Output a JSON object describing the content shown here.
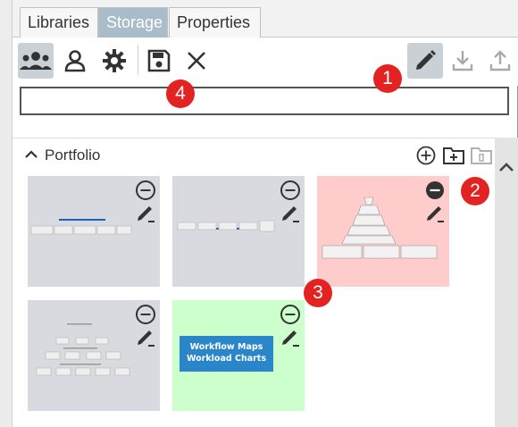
{
  "tabs": [
    {
      "label": "Libraries"
    },
    {
      "label": "Storage"
    },
    {
      "label": "Properties"
    }
  ],
  "toolbar": {
    "icons": [
      "users-icon",
      "user-icon",
      "gear-icon",
      "save-icon",
      "close-icon",
      "edit-icon",
      "download-icon",
      "upload-icon"
    ]
  },
  "search": {
    "value": "",
    "placeholder": ""
  },
  "badges": [
    "1",
    "2",
    "3",
    "4"
  ],
  "library": {
    "title": "Portfolio",
    "items": [
      {
        "thumb_color": "#d9d9e0"
      },
      {
        "thumb_color": "#d9d9e0"
      },
      {
        "thumb_color": "#ffcccc"
      },
      {
        "thumb_color": "#d9d9e0"
      },
      {
        "thumb_color": "#ccffcc",
        "line1": "Workflow Maps",
        "line2": "Workload Charts"
      }
    ]
  },
  "colors": {
    "accent_tab": "#a9bcc9",
    "badge": "#e32222",
    "selected_tool": "#c9d1d7"
  }
}
